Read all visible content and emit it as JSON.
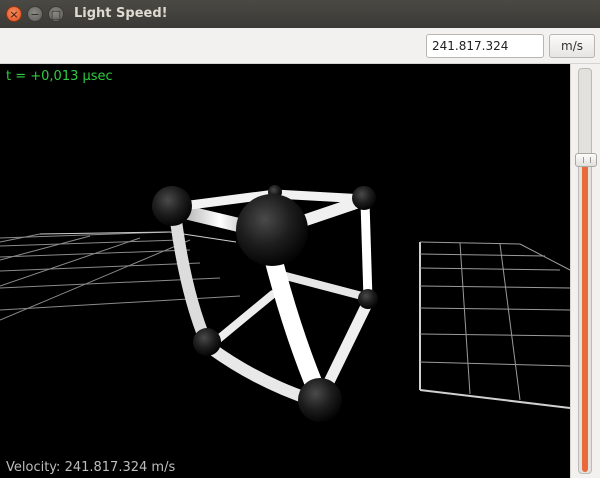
{
  "window": {
    "title": "Light Speed!",
    "close_glyph": "×",
    "minimize_glyph": "−",
    "maximize_glyph": "□"
  },
  "toolbar": {
    "velocity_value": "241.817.324",
    "unit_label": "m/s"
  },
  "viewport": {
    "time_text": "t = +0,013 µsec",
    "status_text": "Velocity: 241.817.324 m/s"
  },
  "slider": {
    "value_fraction": 0.78,
    "accent_color": "#e9693a"
  },
  "colors": {
    "time_text": "#2ecc40",
    "background": "#000000",
    "close_button": "#e0511c"
  },
  "icons": {
    "close": "close-icon",
    "minimize": "minimize-icon",
    "maximize": "maximize-icon"
  }
}
